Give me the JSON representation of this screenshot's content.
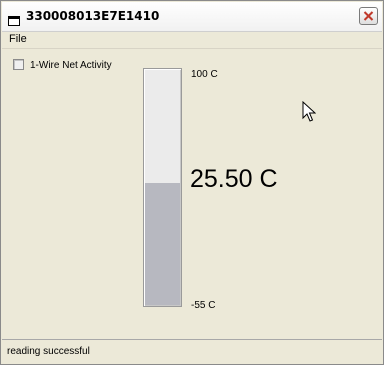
{
  "window": {
    "title": "330008013E7E1410",
    "icons": {
      "app": "window-icon",
      "close": "close-icon"
    }
  },
  "menu": {
    "file_label": "File"
  },
  "options": {
    "net_activity_label": "1-Wire Net Activity",
    "net_activity_checked": false
  },
  "thermometer": {
    "max_label": "100 C",
    "min_label": "-55 C",
    "max_value": 100,
    "min_value": -55,
    "current_value": 25.5,
    "reading_label": "25.50 C",
    "fill_color": "#b7b8c0",
    "empty_color": "#ebebeb"
  },
  "status": {
    "text": "reading successful"
  },
  "cursor": {
    "icon": "mouse-pointer-icon"
  }
}
